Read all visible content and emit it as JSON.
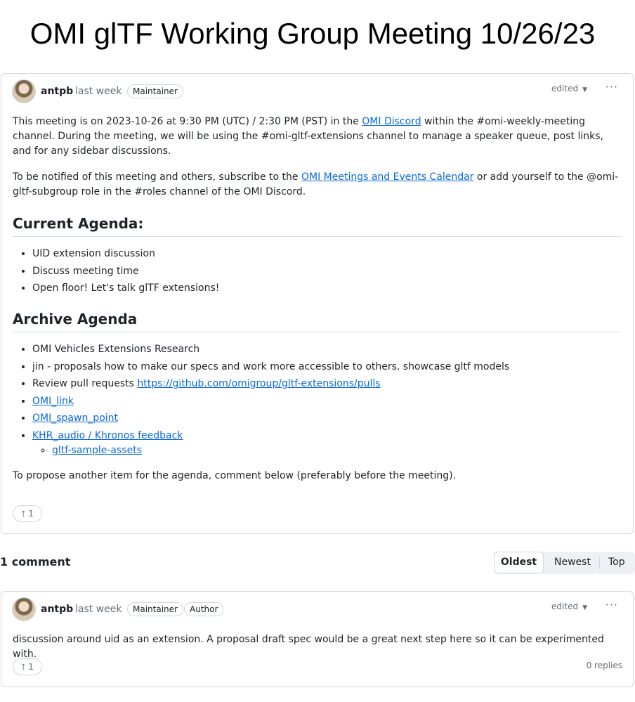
{
  "page_title": "OMI glTF Working Group Meeting 10/26/23",
  "post": {
    "author": "antpb",
    "time": "last week",
    "badge": "Maintainer",
    "edited": "edited",
    "menu": "···",
    "p1_a": "This meeting is on 2023-10-26 at 9:30 PM (UTC) / 2:30 PM (PST) in the ",
    "p1_link": "OMI Discord",
    "p1_b": " within the #omi-weekly-meeting channel. During the meeting, we will be using the #omi-gltf-extensions channel to manage a speaker queue, post links, and for any sidebar discussions.",
    "p2_a": "To be notified of this meeting and others, subscribe to the ",
    "p2_link": "OMI Meetings and Events Calendar",
    "p2_b": " or add yourself to the @omi-gltf-subgroup role in the #roles channel of the OMI Discord.",
    "current_heading": "Current Agenda:",
    "current_items": [
      "UID extension discussion",
      "Discuss meeting time",
      "Open floor! Let's talk glTF extensions!"
    ],
    "archive_heading": "Archive Agenda",
    "archive_items": [
      "OMI Vehicles Extensions Research",
      "jin - proposals how to make our specs and work more accessible to others. showcase gltf models"
    ],
    "review_text": "Review pull requests ",
    "review_link": "https://github.com/omigroup/gltf-extensions/pulls",
    "link_items": [
      "OMI_link",
      "OMI_spawn_point",
      "KHR_audio / Khronos feedback"
    ],
    "sub_link": "gltf-sample-assets",
    "closing": "To propose another item for the agenda, comment below (preferably before the meeting).",
    "upvotes": "1"
  },
  "comments": {
    "count_label": "1 comment",
    "sort": [
      "Oldest",
      "Newest",
      "Top"
    ]
  },
  "comment": {
    "author": "antpb",
    "time": "last week",
    "badge1": "Maintainer",
    "badge2": "Author",
    "edited": "edited",
    "menu": "···",
    "text": "discussion around uid as an extension. A proposal draft spec would be a great next step here so it can be experimented with.",
    "upvotes": "1",
    "replies": "0 replies"
  }
}
